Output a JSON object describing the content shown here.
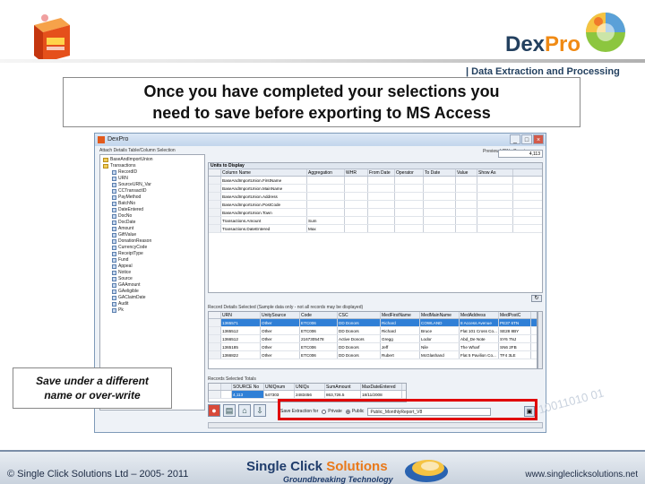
{
  "colors": {
    "accent_orange": "#f08a14",
    "brand_navy": "#23405f",
    "highlight_red": "#e00000",
    "selection_blue": "#2f7fd6"
  },
  "brand": {
    "name_dex": "Dex",
    "name_pro": "Pro",
    "tagline": "| Data Extraction and Processing"
  },
  "callout": {
    "line1": "Once you have completed  your selections you",
    "line2": "need to save before exporting to MS Access"
  },
  "note": {
    "line1": "Save under a different",
    "line2": "name or over-write"
  },
  "app": {
    "title": "DexPro",
    "tree_caption": "Attach Details Table/Column Selection",
    "preview_label": "Preview URNs Count",
    "preview_value": "4,113",
    "tree": [
      {
        "label": "BaseAndImportUnion",
        "folder": true
      },
      {
        "label": "Transactions",
        "folder": true
      },
      {
        "label": "RecordID"
      },
      {
        "label": "URN"
      },
      {
        "label": "SourceURN_Var"
      },
      {
        "label": "CCTransactID"
      },
      {
        "label": "PayMethod"
      },
      {
        "label": "BatchNo"
      },
      {
        "label": "DateEntered"
      },
      {
        "label": "DocNo"
      },
      {
        "label": "DocDate"
      },
      {
        "label": "Amount"
      },
      {
        "label": "GiftValue"
      },
      {
        "label": "DonationReason"
      },
      {
        "label": "CurrencyCode"
      },
      {
        "label": "ReceiptType"
      },
      {
        "label": "Fund"
      },
      {
        "label": "Appeal"
      },
      {
        "label": "Notice"
      },
      {
        "label": "Source"
      },
      {
        "label": "GAAmount"
      },
      {
        "label": "GAeligible"
      },
      {
        "label": "GAClaimDate"
      },
      {
        "label": "Audit"
      },
      {
        "label": "Pk"
      }
    ],
    "grid1": {
      "header": "Units to Display",
      "columns": [
        "Column Name",
        "Aggregation",
        "WHR",
        "From Date",
        "Operator",
        "To Date",
        "Value",
        "Show As"
      ],
      "rows": [
        [
          "BaseAndImportUnion.FirstName",
          "",
          "",
          "",
          "",
          "",
          "",
          ""
        ],
        [
          "BaseAndImportUnion.MainName",
          "",
          "",
          "",
          "",
          "",
          "",
          ""
        ],
        [
          "BaseAndImportUnion.Address",
          "",
          "",
          "",
          "",
          "",
          "",
          ""
        ],
        [
          "BaseAndImportUnion.PostCode",
          "",
          "",
          "",
          "",
          "",
          "",
          ""
        ],
        [
          "BaseAndImportUnion.Town",
          "",
          "",
          "",
          "",
          "",
          "",
          ""
        ],
        [
          "Transactions.Amount",
          "Sum",
          "",
          "",
          "",
          "",
          "",
          ""
        ],
        [
          "Transactions.DateEntered",
          "Max",
          "",
          "",
          "",
          "",
          "",
          ""
        ]
      ]
    },
    "grid2": {
      "caption": "Record Details Selected (Sample data only - not all records may be displayed)",
      "columns": [
        "URN",
        "UnitySource",
        "Code",
        "CSC",
        "MedFirstName",
        "MedMainName",
        "MedAddress",
        "MedPostC"
      ],
      "rows": [
        [
          "1365571",
          "Other",
          "ETC006",
          "DD Donors",
          "Richard",
          "COWLAND",
          "8 Access Avenue",
          "PE37 6TN"
        ],
        [
          "1365512",
          "Other",
          "ETC006",
          "DD Donors",
          "Richard",
          "Bruce",
          "Flat 101 Cross Co...",
          "SE28 8BY"
        ],
        [
          "1366512",
          "Other",
          "2167305478",
          "Active Donors",
          "Gregg",
          "Lodor",
          "Abd_De Note",
          "SY6 7NJ"
        ],
        [
          "1365185",
          "Other",
          "ETC006",
          "DD Donors",
          "Jeff",
          "Nile",
          "The Wharf",
          "SN6 2FB"
        ],
        [
          "1366822",
          "Other",
          "ETC006",
          "DD Donors",
          "Rubert",
          "McGlashand",
          "Flat 5 Pavilion Co...",
          "TF4 3LE"
        ]
      ]
    },
    "grid3": {
      "caption": "Records Selected Totals",
      "columns": [
        "",
        "SOURCE No",
        "UNIQnum",
        "UNIQs",
        "SumAmount",
        "MaxDateEntered"
      ],
      "rows": [
        [
          "",
          "4,113",
          "547303",
          "2483456",
          "863,726.5",
          "18/11/2008"
        ]
      ]
    },
    "save": {
      "label": "Save Extraction for",
      "opt_private": "Private",
      "opt_public": "Public",
      "filename": "Public_MonthlyReport_V8"
    }
  },
  "footer": {
    "copyright": "© Single Click Solutions Ltd – 2005- 2011",
    "company_single": "Single Click ",
    "company_solutions": "Solutions",
    "company_tagline": "Groundbreaking Technology",
    "url": "www.singleclicksolutions.net",
    "deco_digits": "10011010 01"
  }
}
